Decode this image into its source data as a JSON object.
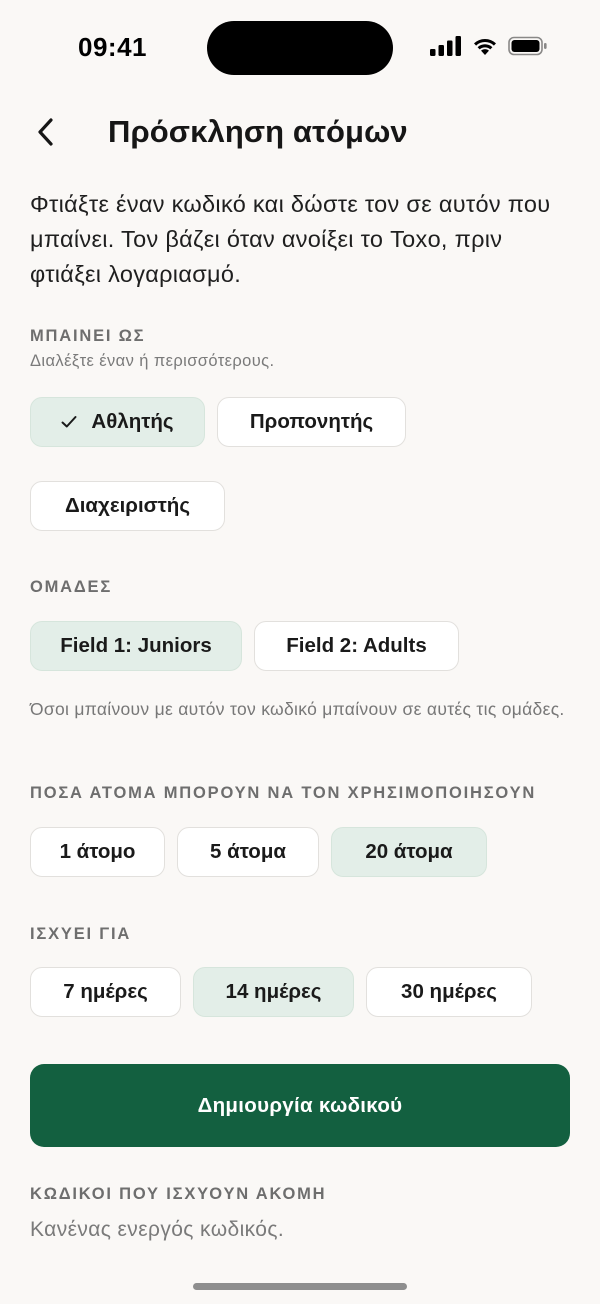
{
  "status_bar": {
    "time": "09:41",
    "icons": [
      "cellular-signal-icon",
      "wifi-icon",
      "battery-icon"
    ]
  },
  "header": {
    "back_icon": "chevron-left-icon",
    "title": "Πρόσκληση ατόμων"
  },
  "intro": "Φτιάξτε έναν κωδικό και δώστε τον σε αυτόν που μπαίνει. Τον βάζει όταν ανοίξει το Toxo, πριν φτιάξει λογαριασμό.",
  "roles": {
    "label": "ΜΠΑΙΝΕΙ ΩΣ",
    "hint": "Διαλέξτε έναν ή περισσότερους.",
    "options": [
      {
        "label": "Αθλητής",
        "selected": true
      },
      {
        "label": "Προπονητής",
        "selected": false
      },
      {
        "label": "Διαχειριστής",
        "selected": false
      }
    ]
  },
  "teams": {
    "label": "ΟΜΑΔΕΣ",
    "options": [
      {
        "label": "Field 1: Juniors",
        "selected": true
      },
      {
        "label": "Field 2: Adults",
        "selected": false
      }
    ],
    "note": "Όσοι μπαίνουν με αυτόν τον κωδικό μπαίνουν σε αυτές τις ομάδες."
  },
  "uses": {
    "label": "ΠΟΣΑ ΑΤΟΜΑ ΜΠΟΡΟΥΝ ΝΑ ΤΟΝ ΧΡΗΣΙΜΟΠΟΙΗΣΟΥΝ",
    "options": [
      {
        "label": "1 άτομο",
        "selected": false
      },
      {
        "label": "5 άτομα",
        "selected": false
      },
      {
        "label": "20 άτομα",
        "selected": true
      }
    ]
  },
  "validity": {
    "label": "ΙΣΧΥΕΙ ΓΙΑ",
    "options": [
      {
        "label": "7 ημέρες",
        "selected": false
      },
      {
        "label": "14 ημέρες",
        "selected": true
      },
      {
        "label": "30 ημέρες",
        "selected": false
      }
    ]
  },
  "create_button": "Δημιουργία κωδικού",
  "active_codes": {
    "label": "ΚΩΔΙΚΟΙ ΠΟΥ ΙΣΧΥΟΥΝ ΑΚΟΜΗ",
    "empty_text": "Κανένας ενεργός κωδικός."
  },
  "colors": {
    "background": "#FAF8F6",
    "accent": "#136040",
    "chip_selected": "#E3EEE8",
    "chip_border": "#E2E0DD"
  }
}
